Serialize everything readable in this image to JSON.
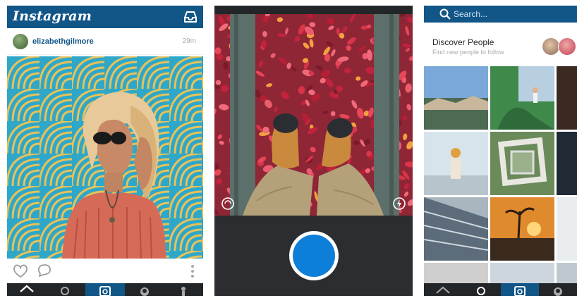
{
  "feed": {
    "logo": "Instagram",
    "post": {
      "username": "elizabethgilmore",
      "time": "29m"
    }
  },
  "camera": {},
  "explore": {
    "search": {
      "placeholder": "Search..."
    },
    "discover": {
      "title": "Discover People",
      "subtitle": "Find new people to follow"
    }
  },
  "colors": {
    "brand_blue": "#125688",
    "tabbar_dark": "#232628",
    "camera_bg": "#2b2d30",
    "shutter_blue": "#0e7fd9"
  },
  "icons": {
    "feed_top": "inbox-icon",
    "feed_actions": [
      "heart-icon",
      "comment-icon",
      "more-vertical-icon"
    ],
    "camera": [
      "flip-camera-icon",
      "flash-icon"
    ],
    "tabbar": [
      "home-icon",
      "search-icon",
      "camera-icon",
      "activity-icon",
      "profile-icon"
    ]
  }
}
